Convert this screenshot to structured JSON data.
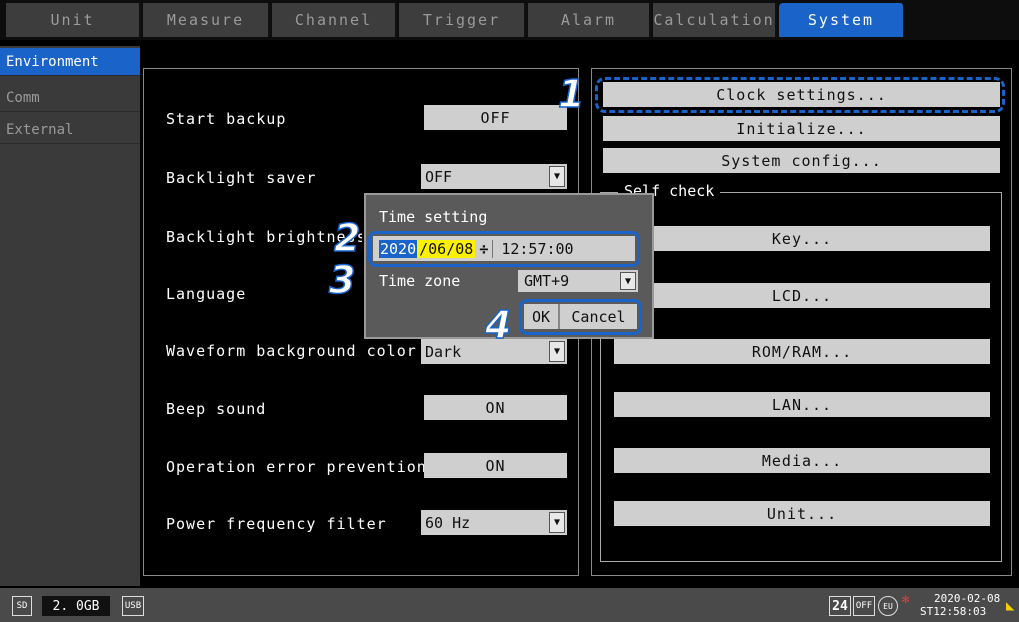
{
  "tabs": [
    {
      "label": "Unit"
    },
    {
      "label": "Measure"
    },
    {
      "label": "Channel"
    },
    {
      "label": "Trigger"
    },
    {
      "label": "Alarm"
    },
    {
      "label": "Calculation"
    },
    {
      "label": "System"
    }
  ],
  "sidebar": {
    "items": [
      {
        "label": "Environment"
      },
      {
        "label": "Comm"
      },
      {
        "label": "External"
      }
    ]
  },
  "settings": {
    "start_backup": {
      "label": "Start backup",
      "value": "OFF"
    },
    "backlight_saver": {
      "label": "Backlight saver",
      "value": "OFF"
    },
    "backlight_brightness": {
      "label": "Backlight brightness"
    },
    "language": {
      "label": "Language"
    },
    "waveform_bg": {
      "label": "Waveform background color",
      "value": "Dark"
    },
    "beep": {
      "label": "Beep sound",
      "value": "ON"
    },
    "op_error": {
      "label": "Operation error prevention",
      "value": "ON"
    },
    "power_filter": {
      "label": "Power frequency filter",
      "value": "60 Hz"
    }
  },
  "right_buttons": {
    "clock": "Clock settings...",
    "initialize": "Initialize...",
    "system_config": "System config..."
  },
  "self_check": {
    "title": "Self check",
    "buttons": [
      "Key...",
      "LCD...",
      "ROM/RAM...",
      "LAN...",
      "Media...",
      "Unit..."
    ]
  },
  "dialog": {
    "title": "Time setting",
    "year": "2020",
    "date_rest": "/06/08",
    "spin": "÷",
    "time": "12:57:00",
    "tz_label": "Time zone",
    "tz_value": "GMT+9",
    "ok": "OK",
    "cancel": "Cancel"
  },
  "callouts": [
    "1",
    "2",
    "3",
    "4"
  ],
  "status": {
    "sd_label": "SD",
    "memory": "2. 0GB",
    "usb_label": "USB",
    "badge_24": "24",
    "badge_off": "OFF",
    "badge_eu": "EU",
    "date": "2020-02-08",
    "time": "ST12:58:03"
  },
  "colors": {
    "accent": "#1a63c8",
    "highlight": "#fdf000",
    "button": "#cfcfcf"
  }
}
